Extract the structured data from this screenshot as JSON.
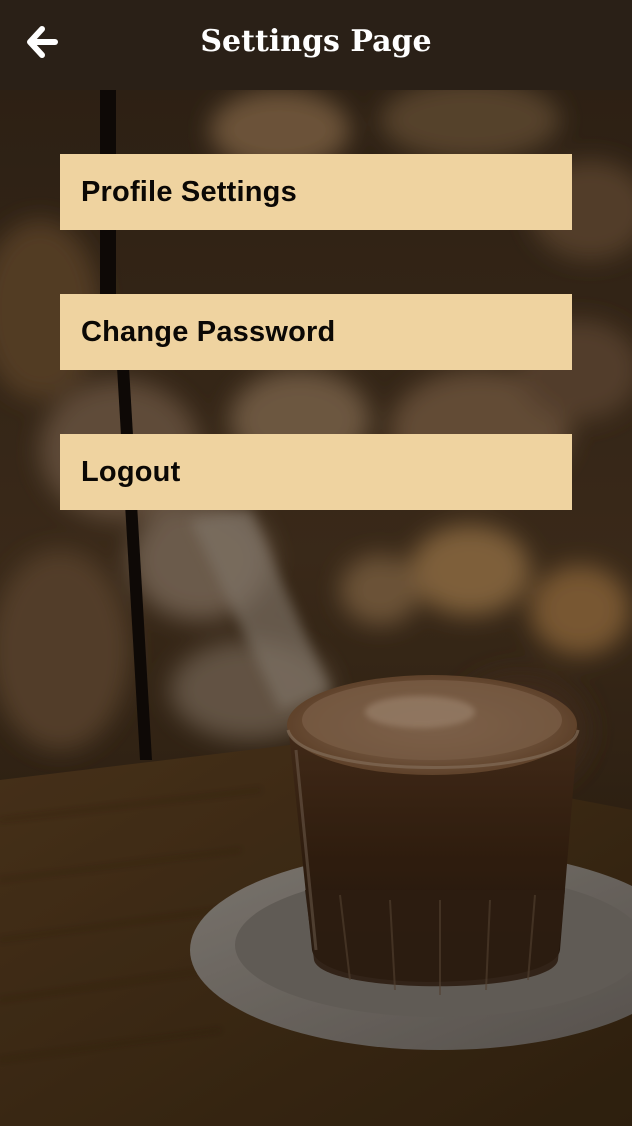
{
  "header": {
    "title": "Settings Page",
    "back_icon": "arrow-left-icon"
  },
  "menu": {
    "items": [
      {
        "label": "Profile Settings"
      },
      {
        "label": "Change Password"
      },
      {
        "label": "Logout"
      }
    ]
  },
  "colors": {
    "header_bg": "#2a2017",
    "menu_item_bg": "#efd3a0",
    "menu_text": "#0b0805",
    "header_text": "#ffffff"
  }
}
